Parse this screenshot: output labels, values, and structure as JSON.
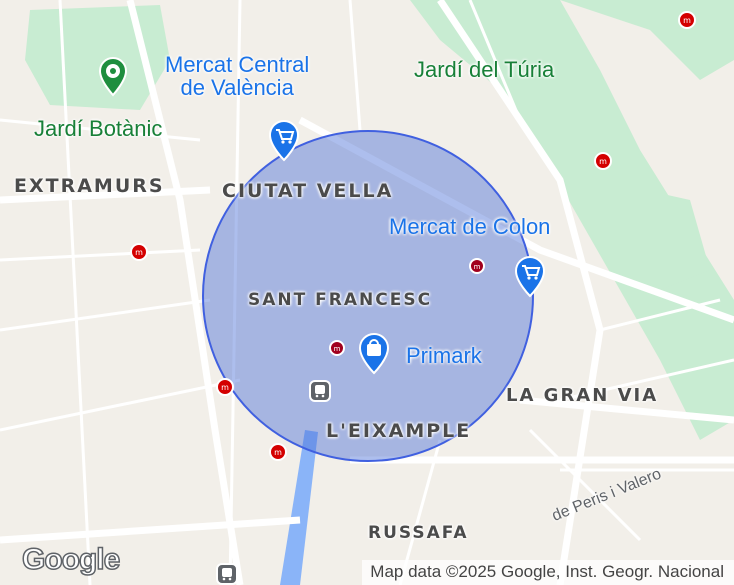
{
  "map": {
    "type": "road-map",
    "districts": [
      "EXTRAMURS",
      "CIUTAT VELLA",
      "SANT FRANCESC",
      "L'EIXAMPLE",
      "LA GRAN VIA",
      "RUSSAFA"
    ],
    "places": {
      "mercat_central": "Mercat Central\nde València",
      "jardi_turia": "Jardí del Túria",
      "jardi_botanic": "Jardí Botànic",
      "mercat_colon": "Mercat de Colon",
      "primark": "Primark"
    },
    "street": "de Peris i Valero",
    "radius_overlay": {
      "fill": "#4a6fd8",
      "stroke": "#4060e0",
      "opacity": 0.45
    },
    "icons": [
      "shopping-cart-icon",
      "shopping-bag-icon",
      "metro-station-icon",
      "train-station-icon",
      "garden-icon"
    ]
  },
  "footer": {
    "logo": "Google",
    "attribution": "Map data ©2025 Google, Inst. Geogr. Nacional"
  },
  "colors": {
    "accent": "#1a73e8",
    "metro": "#d40000",
    "park": "#c8ecd2",
    "water": "#8ab4f8"
  }
}
